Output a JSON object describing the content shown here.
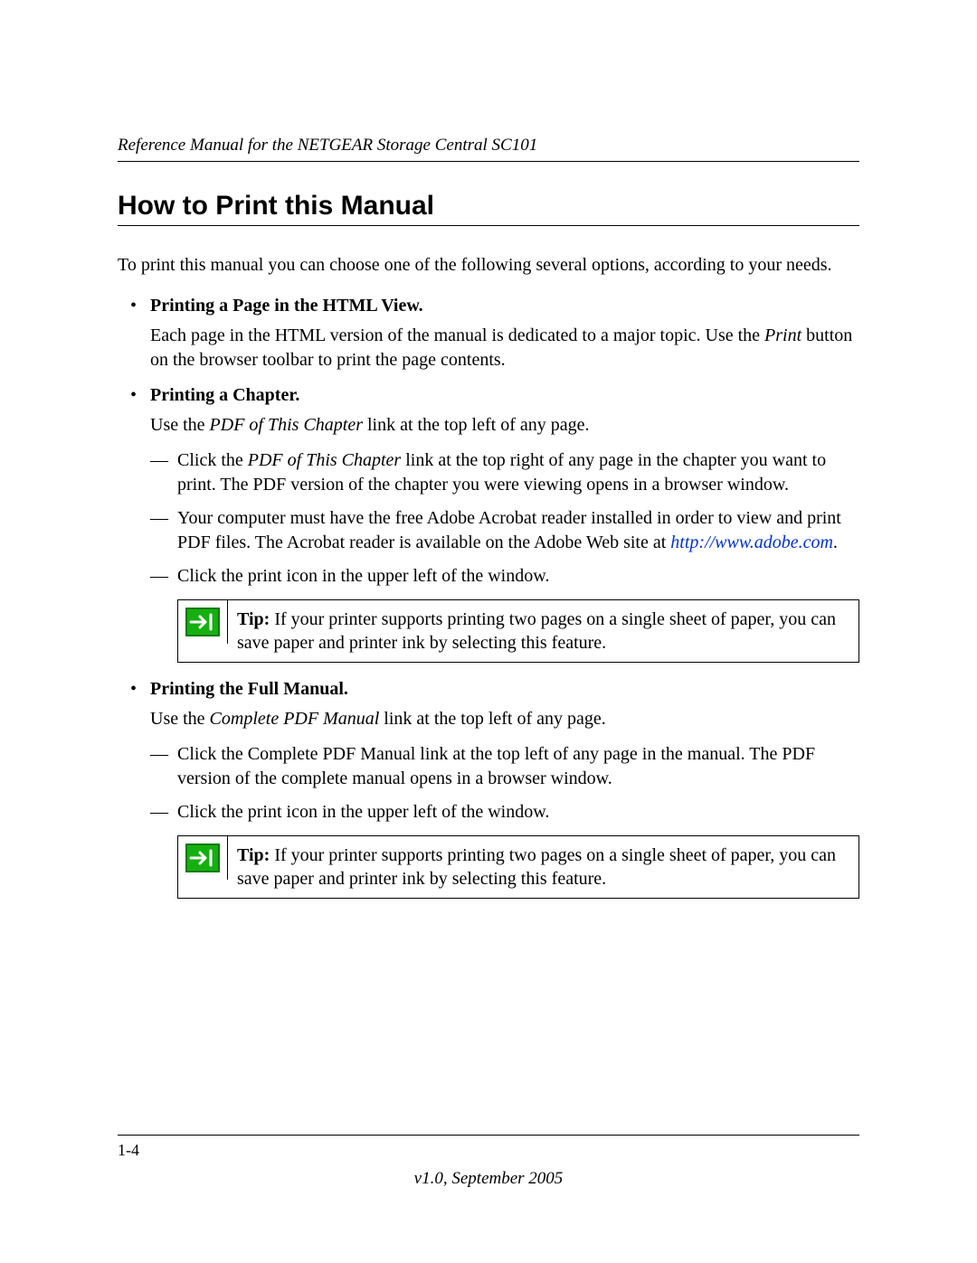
{
  "header": "Reference Manual for the NETGEAR Storage Central SC101",
  "title": "How to Print this Manual",
  "intro": "To print this manual you can choose one of the following several options, according to your needs.",
  "s1": {
    "head": "Printing a Page in the HTML View",
    "p_a": "Each page in the HTML version of the manual is dedicated to a major topic. Use the ",
    "p_i": "Print",
    "p_b": " button on the browser toolbar to print the page contents."
  },
  "s2": {
    "head": "Printing a Chapter",
    "use_a": "Use the ",
    "use_i": "PDF of This Chapter",
    "use_b": " link at the top left of any page.",
    "d1_a": "Click the ",
    "d1_i": "PDF of This Chapter",
    "d1_b": " link at the top right of any page in the chapter you want to print. The PDF version of the chapter you were viewing opens in a browser window.",
    "d2_a": "Your computer must have the free Adobe Acrobat reader installed in order to view and print PDF files. The Acrobat reader is available on the Adobe Web site at ",
    "d2_link": "http://www.adobe.com",
    "d2_b": ".",
    "d3": "Click the print icon in the upper left of the window."
  },
  "tip": {
    "label": "Tip:",
    "body": " If your printer supports printing two pages on a single sheet of paper, you can save paper and printer ink by selecting this feature."
  },
  "s3": {
    "head": "Printing the Full Manual",
    "use_a": "Use the ",
    "use_i": "Complete PDF Manual",
    "use_b": " link at the top left of any page.",
    "d1": "Click the Complete PDF Manual link at the top left of any page in the manual. The PDF version of the complete manual opens in a browser window.",
    "d2": "Click the print icon in the upper left of the window."
  },
  "footer": {
    "page": "1-4",
    "version": "v1.0, September 2005"
  }
}
